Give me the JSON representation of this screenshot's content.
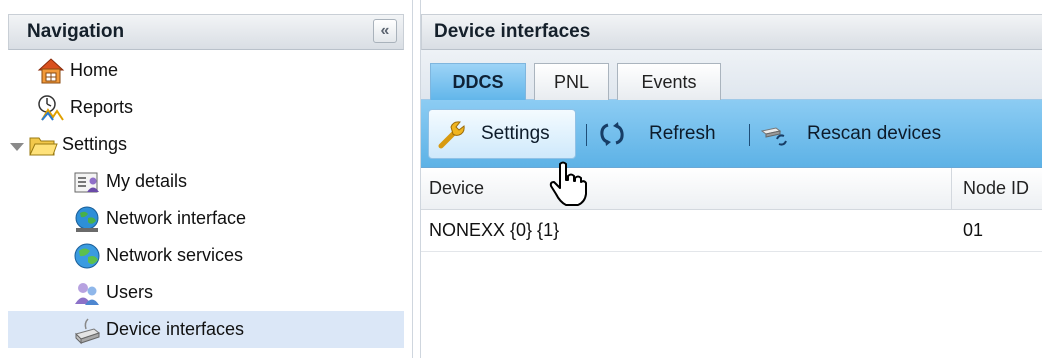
{
  "navigation": {
    "title": "Navigation",
    "collapse_glyph": "«",
    "items": [
      {
        "label": "Home",
        "icon": "home-icon"
      },
      {
        "label": "Reports",
        "icon": "reports-icon"
      },
      {
        "label": "Settings",
        "icon": "folder-open-icon",
        "expanded": true
      },
      {
        "label": "My details",
        "icon": "user-card-icon"
      },
      {
        "label": "Network interface",
        "icon": "network-globe-icon"
      },
      {
        "label": "Network services",
        "icon": "globe-icon"
      },
      {
        "label": "Users",
        "icon": "users-icon"
      },
      {
        "label": "Device interfaces",
        "icon": "device-icon",
        "selected": true
      }
    ]
  },
  "main": {
    "title": "Device interfaces",
    "tabs": [
      {
        "label": "DDCS",
        "active": true
      },
      {
        "label": "PNL",
        "active": false
      },
      {
        "label": "Events",
        "active": false
      }
    ],
    "toolbar": {
      "settings_label": "Settings",
      "refresh_label": "Refresh",
      "rescan_label": "Rescan devices"
    },
    "grid": {
      "columns": [
        "Device",
        "Node ID"
      ],
      "rows": [
        {
          "device": "NONEXX {0} {1}",
          "node_id": "01"
        }
      ]
    }
  },
  "colors": {
    "accent": "#5db2e6",
    "selected": "#dbe7f7"
  }
}
